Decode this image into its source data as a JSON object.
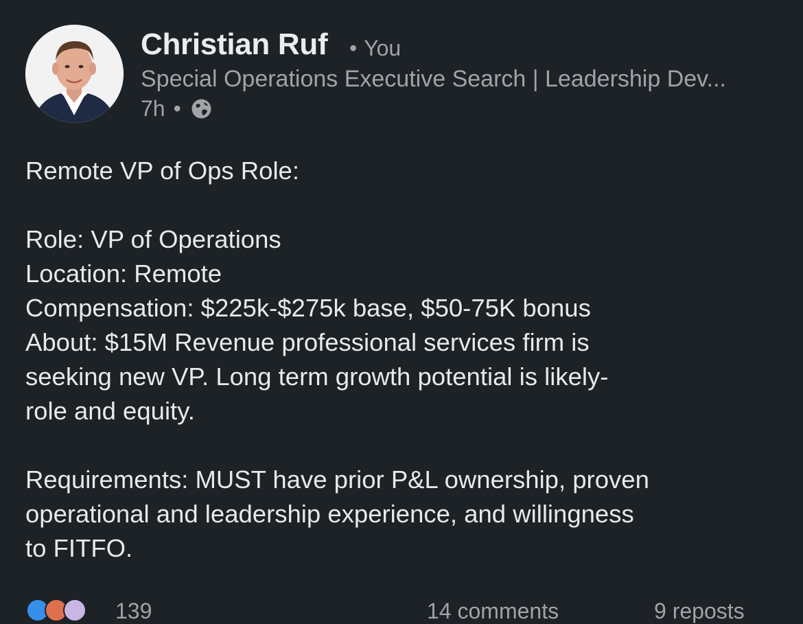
{
  "author": {
    "name": "Christian Ruf",
    "relation": "You",
    "headline": "Special Operations Executive Search | Leadership Dev...",
    "time": "7h",
    "visibility_icon": "globe-icon"
  },
  "post": {
    "lines": [
      "Remote VP of Ops Role:",
      "",
      "Role: VP of Operations",
      "Location: Remote",
      "Compensation: $225k-$275k base, $50-75K bonus",
      "About: $15M Revenue professional services firm is",
      "seeking new VP. Long term growth potential is likely-",
      "role and equity.",
      "",
      "Requirements: MUST have prior P&L ownership, proven",
      "operational and leadership experience, and willingness",
      "to FITFO."
    ]
  },
  "social": {
    "reactions_count": "139",
    "comments": "14 comments",
    "reposts": "9 reposts",
    "reaction_icons": [
      "like-icon",
      "love-icon",
      "support-icon"
    ]
  },
  "colors": {
    "background": "#1d2226",
    "primary_text": "#e9e9ea",
    "secondary_text": "#a0a3a7",
    "like": "#378fe9",
    "love": "#df704d",
    "support": "#c9b6e4"
  }
}
